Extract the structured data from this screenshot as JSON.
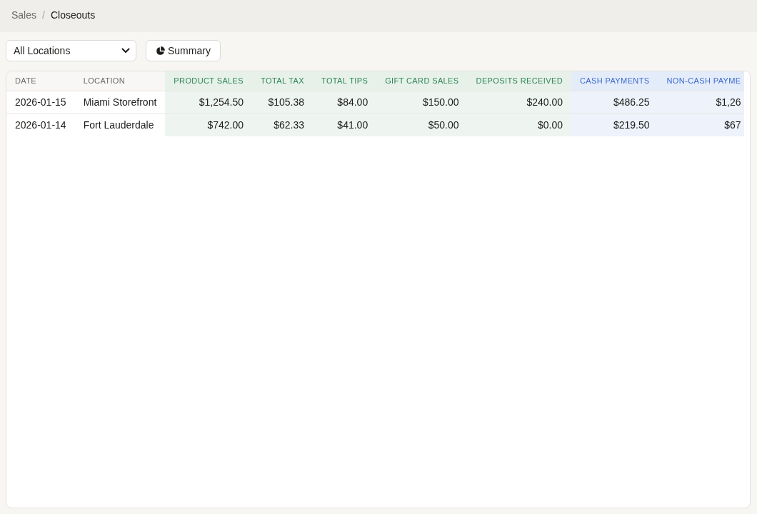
{
  "breadcrumb": {
    "separator": "/",
    "items": [
      {
        "label": "Sales",
        "active": false
      },
      {
        "label": "Closeouts",
        "active": true
      }
    ]
  },
  "toolbar": {
    "location_filter": {
      "value": "All Locations"
    },
    "summary_button": {
      "label": "Summary"
    }
  },
  "table": {
    "columns": [
      {
        "label": "DATE",
        "kind": "info"
      },
      {
        "label": "LOCATION",
        "kind": "info"
      },
      {
        "label": "PRODUCT SALES",
        "kind": "sales"
      },
      {
        "label": "TOTAL TAX",
        "kind": "sales"
      },
      {
        "label": "TOTAL TIPS",
        "kind": "sales"
      },
      {
        "label": "GIFT CARD SALES",
        "kind": "sales"
      },
      {
        "label": "DEPOSITS RECEIVED",
        "kind": "sales"
      },
      {
        "label": "CASH PAYMENTS",
        "kind": "payments"
      },
      {
        "label": "NON-CASH PAYME",
        "kind": "payments"
      }
    ],
    "rows": [
      [
        "2026-01-15",
        "Miami Storefront",
        "$1,254.50",
        "$105.38",
        "$84.00",
        "$150.00",
        "$240.00",
        "$486.25",
        "$1,26"
      ],
      [
        "2026-01-14",
        "Fort Lauderdale",
        "$742.00",
        "$62.33",
        "$41.00",
        "$50.00",
        "$0.00",
        "$219.50",
        "$67"
      ]
    ]
  }
}
